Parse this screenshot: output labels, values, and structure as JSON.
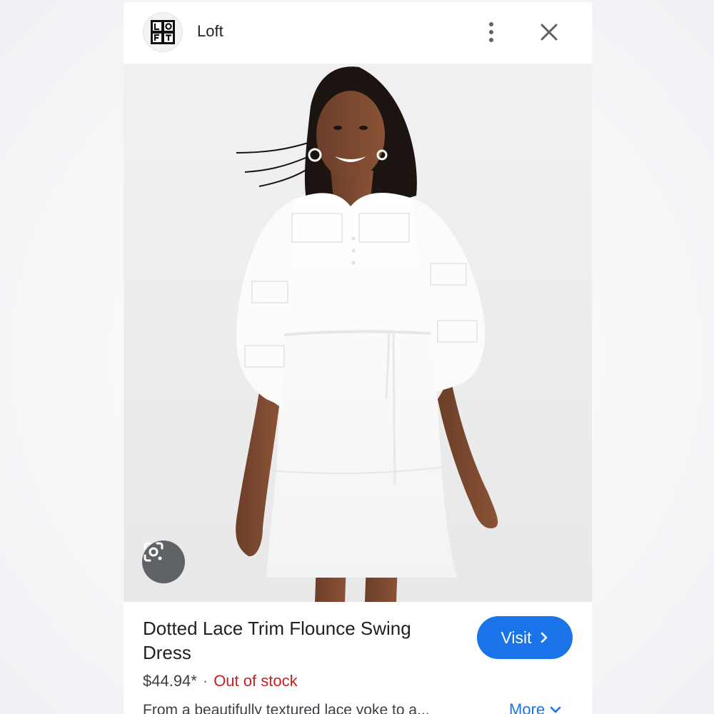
{
  "header": {
    "brand_logo_text": "LOFT",
    "brand_name": "Loft",
    "more_options_icon": "more-vert-icon",
    "close_icon": "close-icon"
  },
  "hero": {
    "lens_icon": "google-lens-icon"
  },
  "product": {
    "title": "Dotted Lace Trim Flounce Swing Dress",
    "price": "$44.94*",
    "separator": "·",
    "stock_status": "Out of stock",
    "description": "From a beautifully textured lace yoke to a...",
    "visit_label": "Visit",
    "more_label": "More"
  },
  "colors": {
    "accent": "#1a73e8",
    "out_of_stock": "#c5221f"
  }
}
